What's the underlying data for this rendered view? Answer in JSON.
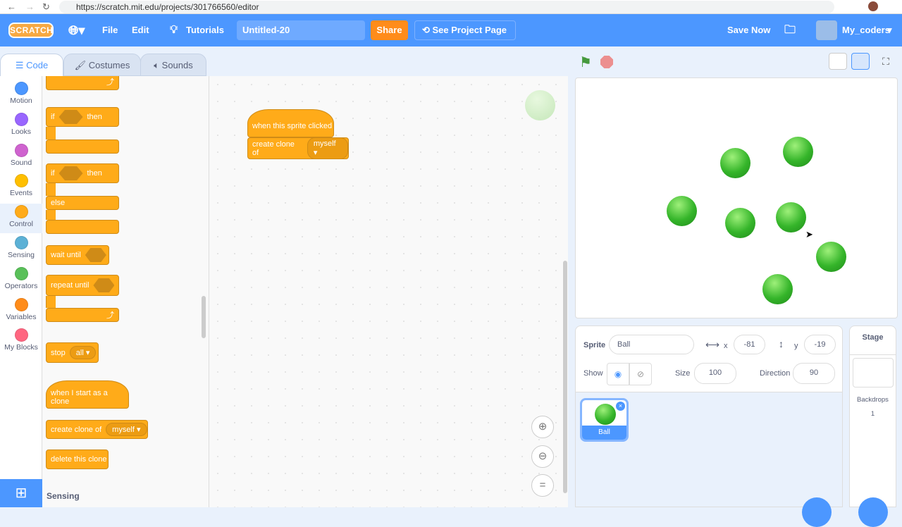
{
  "browser": {
    "url": "https://scratch.mit.edu/projects/301766560/editor"
  },
  "menu": {
    "logo": "SCRATCH",
    "file": "File",
    "edit": "Edit",
    "tutorials": "Tutorials",
    "project_title": "Untitled-20",
    "share": "Share",
    "see_project": "See Project Page",
    "save_now": "Save Now",
    "username": "My_coders"
  },
  "tabs": {
    "code": "Code",
    "costumes": "Costumes",
    "sounds": "Sounds"
  },
  "categories": [
    {
      "label": "Motion",
      "color": "#4c97ff"
    },
    {
      "label": "Looks",
      "color": "#9966ff"
    },
    {
      "label": "Sound",
      "color": "#cf63cf"
    },
    {
      "label": "Events",
      "color": "#ffbf00"
    },
    {
      "label": "Control",
      "color": "#ffab19"
    },
    {
      "label": "Sensing",
      "color": "#5cb1d6"
    },
    {
      "label": "Operators",
      "color": "#59c059"
    },
    {
      "label": "Variables",
      "color": "#ff8c1a"
    },
    {
      "label": "My Blocks",
      "color": "#ff6680"
    }
  ],
  "palette": {
    "if": "if",
    "then": "then",
    "else": "else",
    "wait_until": "wait until",
    "repeat_until": "repeat until",
    "stop": "stop",
    "stop_option": "all",
    "clone_start": "when I start as a clone",
    "create_clone": "create clone of",
    "clone_option": "myself",
    "delete_clone": "delete this clone",
    "next_section": "Sensing"
  },
  "script": {
    "hat": "when this sprite clicked",
    "create_clone": "create clone of",
    "option": "myself"
  },
  "sprite_info": {
    "sprite_label": "Sprite",
    "sprite_name": "Ball",
    "x_label": "x",
    "x": "-81",
    "y_label": "y",
    "y": "-19",
    "show_label": "Show",
    "size_label": "Size",
    "size": "100",
    "direction_label": "Direction",
    "direction": "90"
  },
  "sprites": [
    {
      "name": "Ball"
    }
  ],
  "stage_panel": {
    "title": "Stage",
    "backdrops_label": "Backdrops",
    "backdrops_count": "1"
  },
  "colors": {
    "accent": "#4c97ff",
    "control": "#ffab19",
    "share": "#ff8c1a"
  }
}
